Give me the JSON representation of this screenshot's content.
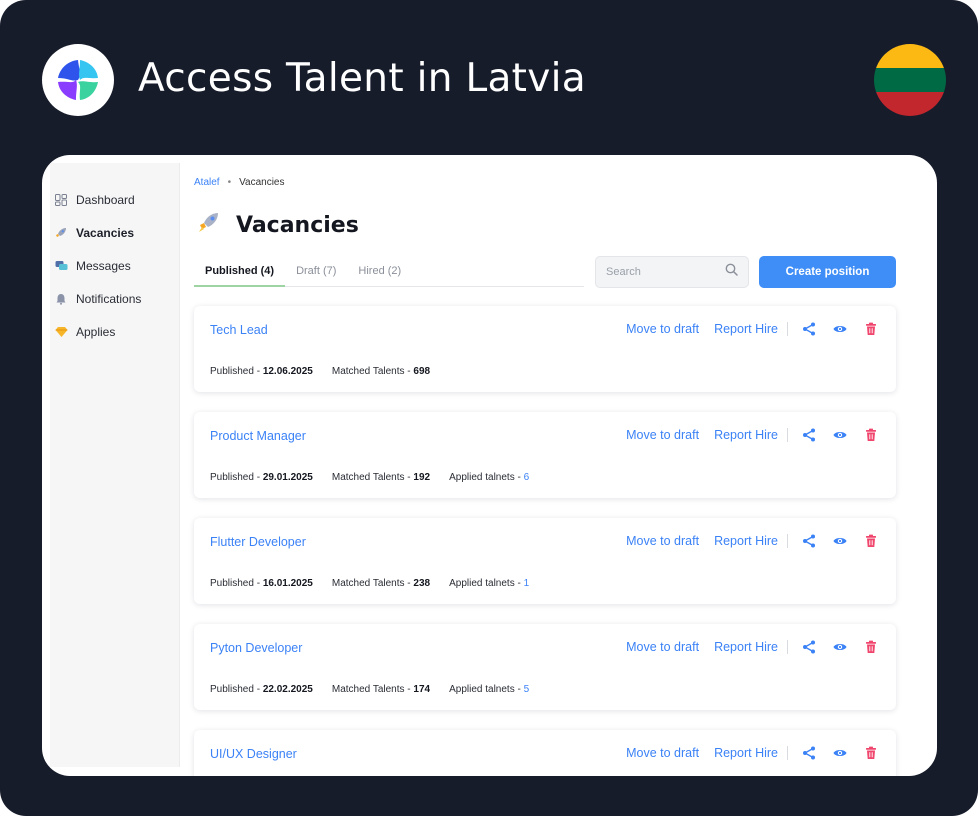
{
  "headline": "Access Talent in Latvia",
  "flag_colors": [
    "#FDB913",
    "#006A44",
    "#C1272D"
  ],
  "sidebar": {
    "items": [
      {
        "label": "Dashboard",
        "icon": "dashboard-icon",
        "active": false
      },
      {
        "label": "Vacancies",
        "icon": "rocket-icon",
        "active": true
      },
      {
        "label": "Messages",
        "icon": "messages-icon",
        "active": false
      },
      {
        "label": "Notifications",
        "icon": "bell-icon",
        "active": false
      },
      {
        "label": "Applies",
        "icon": "diamond-icon",
        "active": false
      }
    ]
  },
  "breadcrumb": {
    "root": "Atalef",
    "current": "Vacancies"
  },
  "page_title": "Vacancies",
  "tabs": [
    {
      "label": "Published (4)",
      "active": true
    },
    {
      "label": "Draft (7)",
      "active": false
    },
    {
      "label": "Hired (2)",
      "active": false
    }
  ],
  "search": {
    "placeholder": "Search"
  },
  "create_button": "Create position",
  "card_actions": {
    "move_to_draft": "Move to draft",
    "report_hire": "Report Hire"
  },
  "meta_labels": {
    "published": "Published - ",
    "matched": "Matched Talents - ",
    "applied": "Applied talnets - "
  },
  "vacancies": [
    {
      "title": "Tech Lead",
      "published": "12.06.2025",
      "matched": "698",
      "applied": null
    },
    {
      "title": "Product Manager",
      "published": "29.01.2025",
      "matched": "192",
      "applied": "6"
    },
    {
      "title": "Flutter Developer",
      "published": "16.01.2025",
      "matched": "238",
      "applied": "1"
    },
    {
      "title": "Pyton Developer",
      "published": "22.02.2025",
      "matched": "174",
      "applied": "5"
    },
    {
      "title": "UI/UX Designer",
      "published": null,
      "matched": null,
      "applied": null
    }
  ],
  "colors": {
    "accent": "#3F8EF7",
    "link": "#3B82F6",
    "delete": "#F0456C",
    "background": "#171C2B"
  }
}
